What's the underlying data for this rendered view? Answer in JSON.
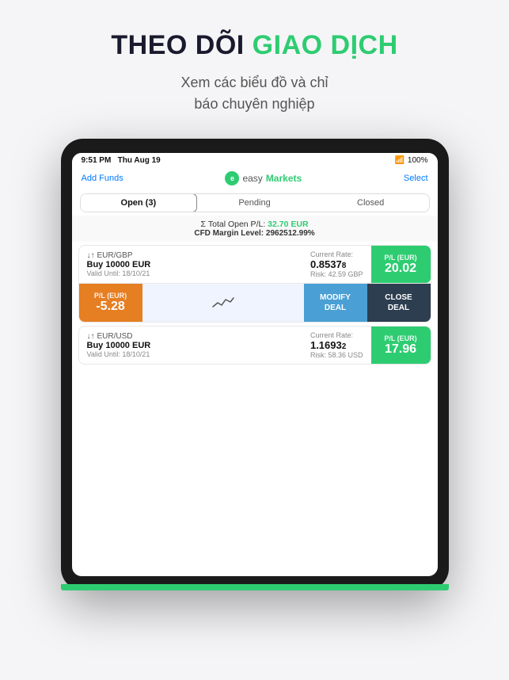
{
  "header": {
    "title_part1": "THEO DÕI",
    "title_part2": "GIAO DỊCH",
    "subtitle_line1": "Xem các biểu đồ và chỉ",
    "subtitle_line2": "báo chuyên nghiệp"
  },
  "ipad": {
    "statusBar": {
      "time": "9:51 PM",
      "date": "Thu Aug 19",
      "wifi": "WiFi",
      "battery": "100%"
    },
    "nav": {
      "addFunds": "Add Funds",
      "logoEasy": "easy",
      "logoMarkets": "Markets",
      "select": "Select"
    },
    "tabs": [
      {
        "label": "Open (3)",
        "active": true
      },
      {
        "label": "Pending",
        "active": false
      },
      {
        "label": "Closed",
        "active": false
      }
    ],
    "summary": {
      "totalOpenLabel": "Total Open P/L:",
      "totalOpenValue": "32.70 EUR",
      "marginLabel": "CFD Margin Level:",
      "marginValue": "2962512.99%"
    },
    "trades": [
      {
        "id": "trade1",
        "pair": "EUR/GBP",
        "direction": "↓↑",
        "amount": "Buy 10000 EUR",
        "valid": "Valid Until: 18/10/21",
        "rateLabel": "Current Rate:",
        "rateMain": "0.8537",
        "rateSmall": "8",
        "risk": "Risk: 42.59 GBP",
        "pnlLabel": "P/L (EUR)",
        "pnlValue": "20.02",
        "positive": true,
        "expanded": true
      },
      {
        "id": "trade2",
        "pair": "EUR/USD",
        "direction": "↓↑",
        "amount": "Buy 10000 EUR",
        "valid": "Valid Until: 18/10/21",
        "rateLabel": "Current Rate:",
        "rateMain": "1.1693",
        "rateSmall": "2",
        "risk": "Risk: 58.36 USD",
        "pnlLabel": "P/L (EUR)",
        "pnlValue": "17.96",
        "positive": true,
        "expanded": false
      }
    ],
    "expandedTrade": {
      "pnlLabel": "P/L (EUR)",
      "pnlValue": "-5.28",
      "modifyLabel": "MODIFY\nDEAL",
      "closeLabel": "CLOSE\nDEAL"
    }
  },
  "colors": {
    "green": "#2ecc71",
    "orange": "#e67e22",
    "blue": "#4a9fd4",
    "dark": "#2d3e50",
    "titleDark": "#1a1a2e"
  }
}
